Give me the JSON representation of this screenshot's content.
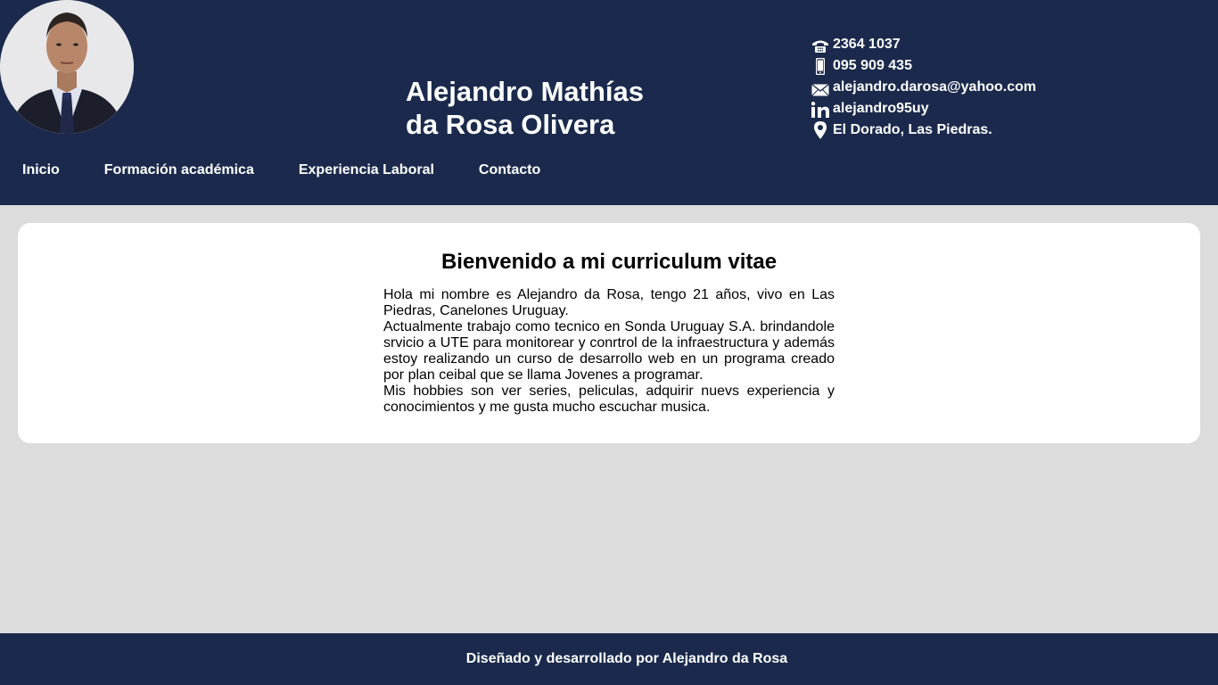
{
  "header": {
    "name_line1": "Alejandro Mathías",
    "name_line2": "da Rosa Olivera",
    "bg_color": "#1b2a4c"
  },
  "contact": {
    "phone": "2364 1037",
    "mobile": "095 909 435",
    "email": "alejandro.darosa@yahoo.com",
    "linkedin": "alejandro95uy",
    "location": "El Dorado, Las Piedras."
  },
  "nav": {
    "items": [
      {
        "label": "Inicio"
      },
      {
        "label": "Formación académica"
      },
      {
        "label": "Experiencia Laboral"
      },
      {
        "label": "Contacto"
      }
    ]
  },
  "main": {
    "title": "Bienvenido a mi curriculum vitae",
    "paragraph1": "Hola mi nombre es Alejandro da Rosa, tengo 21 años, vivo en Las Piedras, Canelones Uruguay.",
    "paragraph2": "Actualmente trabajo como tecnico en Sonda Uruguay S.A. brindandole srvicio a UTE para monitorear y conrtrol de la infraestructura y además estoy realizando un curso de desarrollo web en un programa creado por plan ceibal que se llama Jovenes a programar.",
    "paragraph3": "Mis hobbies son ver series, peliculas, adquirir nuevs experiencia y conocimientos y me gusta mucho escuchar musica."
  },
  "footer": {
    "text": "Diseñado y desarrollado por Alejandro da Rosa"
  },
  "icons": {
    "phone": "telephone-icon",
    "mobile": "mobile-phone-icon",
    "email": "envelope-icon",
    "linkedin": "linkedin-icon",
    "location": "map-pin-icon"
  }
}
